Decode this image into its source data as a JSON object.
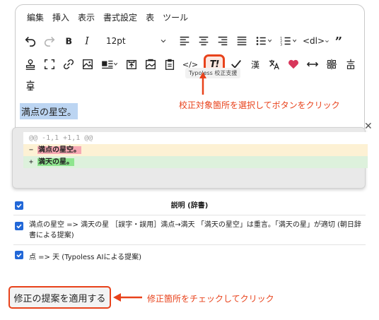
{
  "menubar": {
    "items": [
      "編集",
      "挿入",
      "表示",
      "書式設定",
      "表",
      "ツール"
    ]
  },
  "toolbar": {
    "font_size": "12pt",
    "dl_select": "<dl>",
    "code_label": "</>",
    "typoless_label": "T!",
    "kanji_label": "漢",
    "typoless_tooltip": "Typoless 校正支援"
  },
  "editor": {
    "content": "満点の星空。"
  },
  "annotations": {
    "select_hint": "校正対象箇所を選択してボタンをクリック",
    "check_hint": "修正箇所をチェックしてクリック"
  },
  "diff": {
    "header": "@@ -1,1 +1,1 @@",
    "removed": {
      "marker": "−",
      "text": "満点の星空。"
    },
    "added": {
      "marker": "+",
      "text": "満天の星。"
    }
  },
  "suggestions": {
    "header": "説明 (辞書)",
    "items": [
      {
        "checked": true,
        "text": "満点の星空 => 満天の星 ［誤字・誤用］満点→満天 「満天の星空」は重言。「満天の星」が適切 (朝日辞書による提案)"
      },
      {
        "checked": true,
        "text": "点 => 天 (Typoless AIによる提案)"
      }
    ]
  },
  "apply_button": {
    "label": "修正の提案を適用する"
  },
  "colors": {
    "accent": "#e8421b",
    "checkbox": "#2268d8",
    "selection": "#bcd5f2"
  }
}
